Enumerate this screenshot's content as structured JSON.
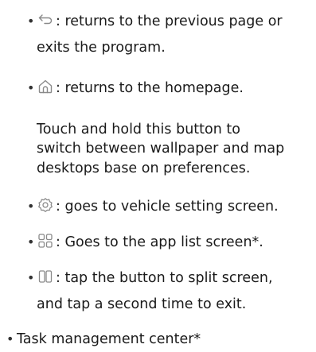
{
  "items": [
    {
      "icon": "back-arrow-icon",
      "line1": ": returns to the previous page or",
      "line2": "exits the program."
    },
    {
      "icon": "home-icon",
      "line1": ": returns to the homepage."
    },
    {
      "icon": "settings-gear-icon",
      "line1": ": goes to vehicle setting screen."
    },
    {
      "icon": "app-grid-icon",
      "line1": ": Goes to the app list screen*."
    },
    {
      "icon": "split-screen-icon",
      "line1": ": tap the button to split screen,",
      "line2": "and tap a second time to exit."
    }
  ],
  "home_note": {
    "line1": "Touch and hold this button to",
    "line2": "switch between wallpaper and map",
    "line3": "desktops base on preferences."
  },
  "task_center": "Task management center*",
  "bullet_char": "•",
  "icon_color": "#8a8a8a"
}
